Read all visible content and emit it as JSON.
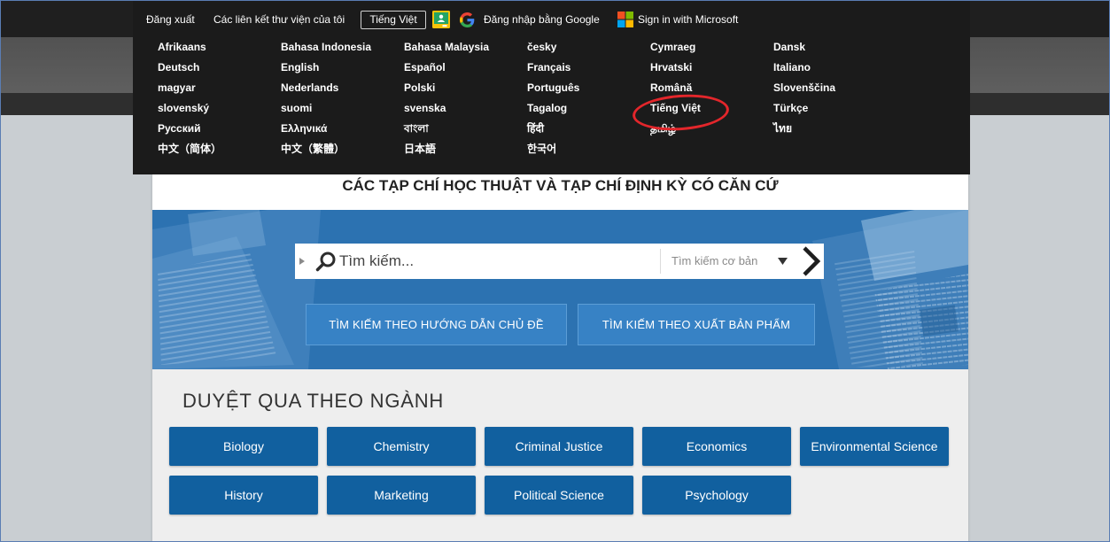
{
  "top_nav": {
    "logout_label": "Đăng xuất",
    "library_links_label": "Các liên kết thư viện của tôi",
    "current_language": "Tiếng Việt",
    "google_signin_label": "Đăng nhập bằng Google",
    "microsoft_signin_label": "Sign in with Microsoft"
  },
  "languages": [
    "Afrikaans",
    "Bahasa Indonesia",
    "Bahasa Malaysia",
    "česky",
    "Cymraeg",
    "Dansk",
    "Deutsch",
    "English",
    "Español",
    "Français",
    "Hrvatski",
    "Italiano",
    "magyar",
    "Nederlands",
    "Polski",
    "Português",
    "Română",
    "Slovenščina",
    "slovenský",
    "suomi",
    "svenska",
    "Tagalog",
    "Tiếng Việt",
    "Türkçe",
    "Русский",
    "Ελληνικά",
    "বাংলা",
    "हिंदी",
    "தமிழ்",
    "ไทย",
    "中文（简体）",
    "中文（繁體）",
    "日本語",
    "한국어"
  ],
  "main": {
    "title": "CÁC TẠP CHÍ HỌC THUẬT VÀ TẠP CHÍ ĐỊNH KỲ CÓ CĂN CỨ",
    "search": {
      "placeholder": "Tìm kiếm...",
      "mode": "Tìm kiếm cơ bản"
    },
    "search_buttons": {
      "by_subject_guide": "TÌM KIẾM THEO HƯỚNG DẪN CHỦ ĐỀ",
      "by_publication": "TÌM KIẾM THEO XUẤT BẢN PHẨM"
    },
    "browse": {
      "heading": "DUYỆT QUA THEO NGÀNH",
      "subjects": [
        "Biology",
        "Chemistry",
        "Criminal Justice",
        "Economics",
        "Environmental Science",
        "History",
        "Marketing",
        "Political Science",
        "Psychology"
      ]
    }
  },
  "icons": {
    "google_classroom": "google-classroom-icon",
    "google": "google-g-icon",
    "microsoft": "microsoft-logo-icon",
    "search_expand": "caret-right-icon",
    "search": "search-icon",
    "search_mode": "caret-down-icon",
    "search_submit": "chevron-right-icon"
  },
  "colors": {
    "page_background": "#c9ced2",
    "dropdown_background": "#1b1b1b",
    "hero_blue": "#2c72b1",
    "hero_button": "#3782c5",
    "subject_button": "#11609f",
    "annotation_red": "#e3262b"
  }
}
